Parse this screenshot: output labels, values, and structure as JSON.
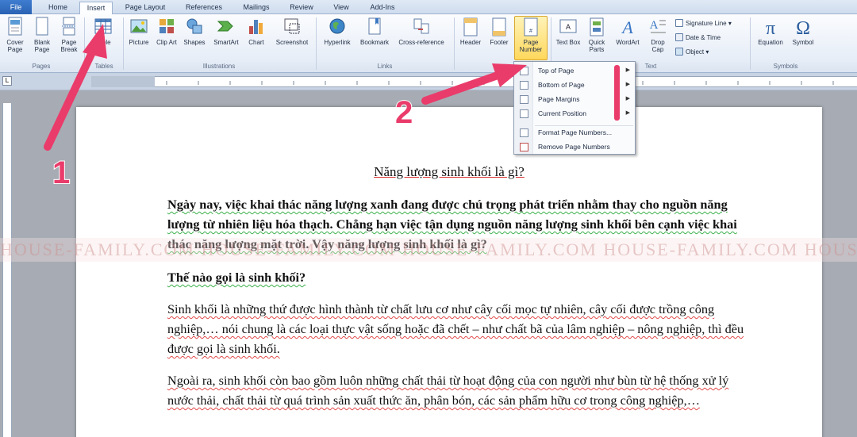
{
  "tabs": [
    "File",
    "Home",
    "Insert",
    "Page Layout",
    "References",
    "Mailings",
    "Review",
    "View",
    "Add-Ins"
  ],
  "active_tab": "Insert",
  "ribbon": {
    "pages": {
      "label": "Pages",
      "cover_page": "Cover Page",
      "blank_page": "Blank Page",
      "page_break": "Page Break"
    },
    "tables": {
      "label": "Tables",
      "table": "Table"
    },
    "illustrations": {
      "label": "Illustrations",
      "picture": "Picture",
      "clip_art": "Clip Art",
      "shapes": "Shapes",
      "smartart": "SmartArt",
      "chart": "Chart",
      "screenshot": "Screenshot"
    },
    "links": {
      "label": "Links",
      "hyperlink": "Hyperlink",
      "bookmark": "Bookmark",
      "cross_reference": "Cross-reference"
    },
    "header_footer": {
      "header": "Header",
      "footer": "Footer",
      "page_number": "Page Number"
    },
    "text": {
      "label": "Text",
      "text_box": "Text Box",
      "quick_parts": "Quick Parts",
      "wordart": "WordArt",
      "drop_cap": "Drop Cap",
      "signature_line": "Signature Line",
      "date_time": "Date & Time",
      "object": "Object"
    },
    "symbols": {
      "label": "Symbols",
      "equation": "Equation",
      "symbol": "Symbol"
    }
  },
  "page_number_menu": {
    "items": [
      "Top of Page",
      "Bottom of Page",
      "Page Margins",
      "Current Position",
      "Format Page Numbers...",
      "Remove Page Numbers"
    ]
  },
  "annotations": {
    "step1": "1",
    "step2": "2"
  },
  "watermark": "HOUSE-FAMILY.COM   HOUSE-FAMILY.COM   HOUSE-FAMILY.COM   HOUSE-FAMILY.COM   HOUSE-FAMILY.COM",
  "document": {
    "title": "Năng lượng sinh khối là gì?",
    "p1": "Ngày nay, việc khai thác năng lượng xanh đang được chú trọng phát triển nhằm thay cho nguồn năng lượng từ nhiên liệu hóa thạch. Chẳng hạn việc tận dụng nguồn năng lượng sinh khối bên cạnh việc khai thác năng lượng mặt trời. Vậy năng lượng sinh khối là gì?",
    "h2": "Thế nào gọi là sinh khối?",
    "p2": "Sinh khối là những thứ được hình thành từ chất lưu cơ như cây cối mọc tự nhiên, cây cối được trồng công nghiệp,… nói chung là các loại thực vật sống hoặc đã chết – như chất bã của lâm nghiệp – nông nghiệp, thì đều được gọi là sinh khối.",
    "p3": "Ngoài ra, sinh khối còn bao gồm luôn những chất thải từ hoạt động của con người như bùn từ hệ thống xử lý nước thải, chất thải từ quá trình sản xuất thức ăn, phân bón, các sản phẩm hữu cơ trong công nghiệp,…"
  }
}
